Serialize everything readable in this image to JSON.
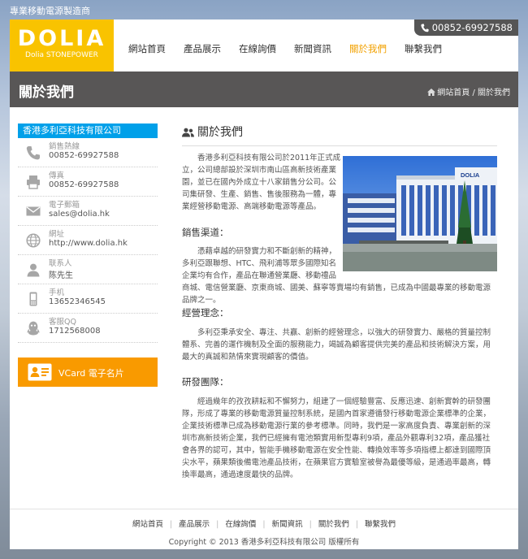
{
  "tagline": "專業移動電源製造商",
  "logo": {
    "name": "DOLIA",
    "sub": "Dolia STONEPOWER"
  },
  "phone": "00852-69927588",
  "nav": [
    "網站首頁",
    "產品展示",
    "在線詢價",
    "新聞資訊",
    "關於我們",
    "聯繫我們"
  ],
  "nav_active_index": 4,
  "banner": {
    "title": "關於我們",
    "breadcrumb": "網站首頁 / 關於我們"
  },
  "sidebar": {
    "company": "香港多利亞科技有限公司",
    "items": [
      {
        "icon": "phone-icon",
        "label": "銷售熱線",
        "value": "00852-69927588"
      },
      {
        "icon": "printer-icon",
        "label": "傳真",
        "value": "00852-69927588"
      },
      {
        "icon": "mail-icon",
        "label": "電子郵箱",
        "value": "sales@dolia.hk"
      },
      {
        "icon": "globe-icon",
        "label": "網址",
        "value": "http://www.dolia.hk"
      },
      {
        "icon": "user-icon",
        "label": "联系人",
        "value": "陈先生"
      },
      {
        "icon": "mobile-icon",
        "label": "手机",
        "value": "13652346545"
      },
      {
        "icon": "qq-icon",
        "label": "客服QQ",
        "value": "1712568008"
      }
    ],
    "vcard": "VCard 電子名片"
  },
  "main": {
    "title": "關於我們",
    "photo_sign": "DOLIA",
    "intro": "香港多利亞科技有限公司於2011年正式成立，公司總部設於深圳市南山區高新技術產業園，並已在國內外成立十八家銷售分公司。公司集研發、生產、銷售、售後服務為一體，專業經營移動電源、高端移動電源等產品。",
    "sections": [
      {
        "heading": "銷售渠道：",
        "text": "憑藉卓越的研發實力和不斷創新的精神，多利亞跟聯想、HTC、飛利浦等眾多國際知名企業均有合作，產品在聯通營業廳、移動禮品商城、電信營業廳、京東商城、國美、蘇寧等賣場均有銷售，已成為中國最專業的移動電源品牌之一。"
      },
      {
        "heading": "經營理念：",
        "text": "多利亞秉承安全、專注、共贏、創新的經營理念，以強大的研發實力、嚴格的質量控制體系、完善的運作機制及全面的服務能力，竭誠為顧客提供完美的產品和技術解決方案，用最大的真誠和熱情來實現顧客的價值。"
      },
      {
        "heading": "研發團隊：",
        "text": "經過幾年的孜孜耕耘和不懈努力，組建了一個經驗豐富、反應迅速、創新實幹的研發團隊，形成了專業的移動電源質量控制系統，是國內首家遵循發行移動電源企業標準的企業，企業技術標準已成為移動電源行業的參考標準。同時，我們是一家高度負責、專業創新的深圳市高新技術企業，我們已經擁有電池類實用新型專利9項，產品外觀專利32項，產品獲社會各界的認可，其中，智能手機移動電源在安全性能、轉換效率等多項指標上都達到國際頂尖水平，蘋果類後備電池產品技術，在蘋果官方實驗室被譽為最優等級，是通過率最高，轉換率最高，通過速度最快的品牌。"
      }
    ]
  },
  "footer": {
    "links": [
      "網站首頁",
      "產品展示",
      "在線詢價",
      "新聞資訊",
      "關於我們",
      "聯繫我們"
    ],
    "copyright": "Copyright © 2013 香港多利亞科技有限公司 版權所有"
  },
  "colors": {
    "logo": "#f9c300",
    "accent": "#f2a100",
    "sidebar_bar": "#00a0e9",
    "vcard": "#f99a00",
    "banner": "#585656"
  }
}
